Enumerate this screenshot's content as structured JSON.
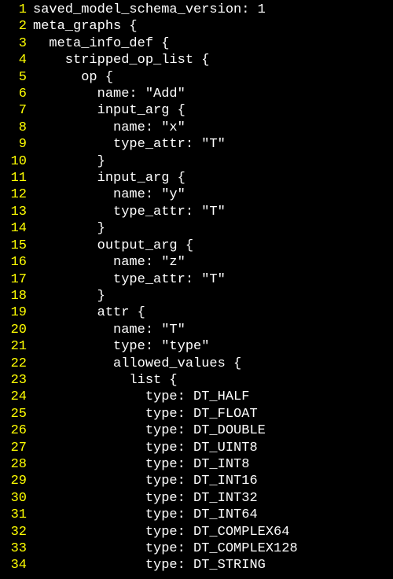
{
  "lines": [
    {
      "n": "1",
      "indent": 0,
      "text": "saved_model_schema_version: 1"
    },
    {
      "n": "2",
      "indent": 0,
      "text": "meta_graphs {"
    },
    {
      "n": "3",
      "indent": 2,
      "text": "meta_info_def {"
    },
    {
      "n": "4",
      "indent": 4,
      "text": "stripped_op_list {"
    },
    {
      "n": "5",
      "indent": 6,
      "text": "op {"
    },
    {
      "n": "6",
      "indent": 8,
      "text": "name: \"Add\""
    },
    {
      "n": "7",
      "indent": 8,
      "text": "input_arg {"
    },
    {
      "n": "8",
      "indent": 10,
      "text": "name: \"x\""
    },
    {
      "n": "9",
      "indent": 10,
      "text": "type_attr: \"T\""
    },
    {
      "n": "10",
      "indent": 8,
      "text": "}"
    },
    {
      "n": "11",
      "indent": 8,
      "text": "input_arg {"
    },
    {
      "n": "12",
      "indent": 10,
      "text": "name: \"y\""
    },
    {
      "n": "13",
      "indent": 10,
      "text": "type_attr: \"T\""
    },
    {
      "n": "14",
      "indent": 8,
      "text": "}"
    },
    {
      "n": "15",
      "indent": 8,
      "text": "output_arg {"
    },
    {
      "n": "16",
      "indent": 10,
      "text": "name: \"z\""
    },
    {
      "n": "17",
      "indent": 10,
      "text": "type_attr: \"T\""
    },
    {
      "n": "18",
      "indent": 8,
      "text": "}"
    },
    {
      "n": "19",
      "indent": 8,
      "text": "attr {"
    },
    {
      "n": "20",
      "indent": 10,
      "text": "name: \"T\""
    },
    {
      "n": "21",
      "indent": 10,
      "text": "type: \"type\""
    },
    {
      "n": "22",
      "indent": 10,
      "text": "allowed_values {"
    },
    {
      "n": "23",
      "indent": 12,
      "text": "list {"
    },
    {
      "n": "24",
      "indent": 14,
      "text": "type: DT_HALF"
    },
    {
      "n": "25",
      "indent": 14,
      "text": "type: DT_FLOAT"
    },
    {
      "n": "26",
      "indent": 14,
      "text": "type: DT_DOUBLE"
    },
    {
      "n": "27",
      "indent": 14,
      "text": "type: DT_UINT8"
    },
    {
      "n": "28",
      "indent": 14,
      "text": "type: DT_INT8"
    },
    {
      "n": "29",
      "indent": 14,
      "text": "type: DT_INT16"
    },
    {
      "n": "30",
      "indent": 14,
      "text": "type: DT_INT32"
    },
    {
      "n": "31",
      "indent": 14,
      "text": "type: DT_INT64"
    },
    {
      "n": "32",
      "indent": 14,
      "text": "type: DT_COMPLEX64"
    },
    {
      "n": "33",
      "indent": 14,
      "text": "type: DT_COMPLEX128"
    },
    {
      "n": "34",
      "indent": 14,
      "text": "type: DT_STRING"
    }
  ]
}
